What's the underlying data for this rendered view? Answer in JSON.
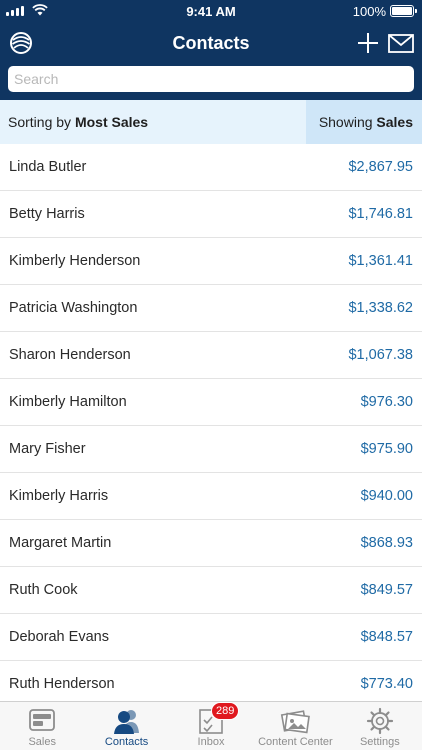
{
  "status": {
    "time": "9:41 AM",
    "battery": "100%"
  },
  "header": {
    "title": "Contacts"
  },
  "search": {
    "placeholder": "Search"
  },
  "sort": {
    "sorting_prefix": "Sorting by ",
    "sorting_value": "Most Sales",
    "showing_prefix": "Showing ",
    "showing_value": "Sales"
  },
  "contacts": [
    {
      "name": "Linda Butler",
      "amount": "$2,867.95"
    },
    {
      "name": "Betty Harris",
      "amount": "$1,746.81"
    },
    {
      "name": "Kimberly Henderson",
      "amount": "$1,361.41"
    },
    {
      "name": "Patricia Washington",
      "amount": "$1,338.62"
    },
    {
      "name": "Sharon Henderson",
      "amount": "$1,067.38"
    },
    {
      "name": "Kimberly Hamilton",
      "amount": "$976.30"
    },
    {
      "name": "Mary Fisher",
      "amount": "$975.90"
    },
    {
      "name": "Kimberly Harris",
      "amount": "$940.00"
    },
    {
      "name": "Margaret Martin",
      "amount": "$868.93"
    },
    {
      "name": "Ruth Cook",
      "amount": "$849.57"
    },
    {
      "name": "Deborah Evans",
      "amount": "$848.57"
    },
    {
      "name": "Ruth Henderson",
      "amount": "$773.40"
    }
  ],
  "tabs": [
    {
      "label": "Sales",
      "icon": "sales-icon"
    },
    {
      "label": "Contacts",
      "icon": "contacts-icon",
      "active": true
    },
    {
      "label": "Inbox",
      "icon": "inbox-icon",
      "badge": "289"
    },
    {
      "label": "Content Center",
      "icon": "content-center-icon"
    },
    {
      "label": "Settings",
      "icon": "gear-icon"
    }
  ],
  "colors": {
    "navbar": "#0f3561",
    "accent": "#1f6aa5",
    "sort_bg": "#e6f3fc",
    "badge": "#e0191f"
  }
}
